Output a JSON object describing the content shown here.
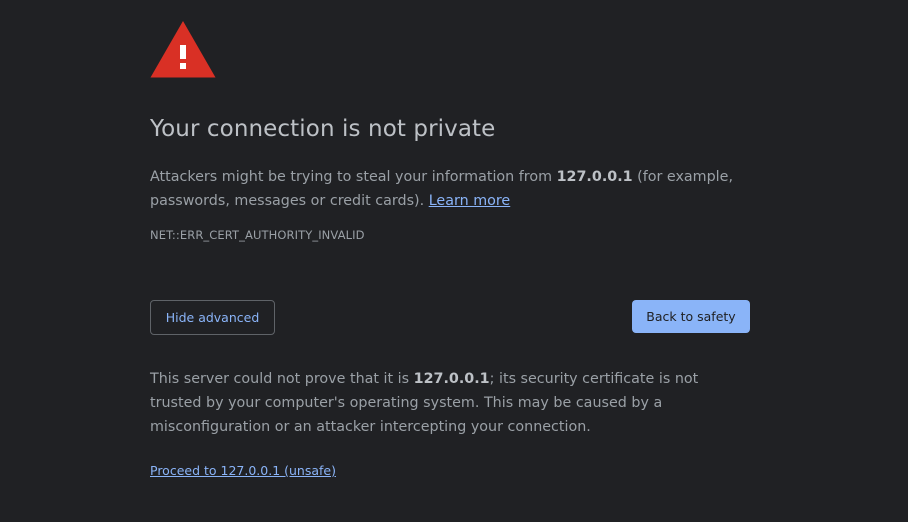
{
  "interstitial": {
    "heading": "Your connection is not private",
    "description": {
      "before_host": "Attackers might be trying to steal your information from ",
      "host": "127.0.0.1",
      "after_host": " (for example, passwords, messages or credit cards). ",
      "learn_more": "Learn more"
    },
    "error_code": "NET::ERR_CERT_AUTHORITY_INVALID",
    "buttons": {
      "advanced": "Hide advanced",
      "safety": "Back to safety"
    },
    "details": {
      "before_host": "This server could not prove that it is ",
      "host": "127.0.0.1",
      "after_host": "; its security certificate is not trusted by your computer's operating system. This may be caused by a misconfiguration or an attacker intercepting your connection."
    },
    "proceed_link": "Proceed to 127.0.0.1 (unsafe)",
    "icon": "warning-triangle-icon",
    "colors": {
      "background": "#202124",
      "warning_red": "#d93025",
      "accent_blue": "#8ab4f8"
    }
  }
}
